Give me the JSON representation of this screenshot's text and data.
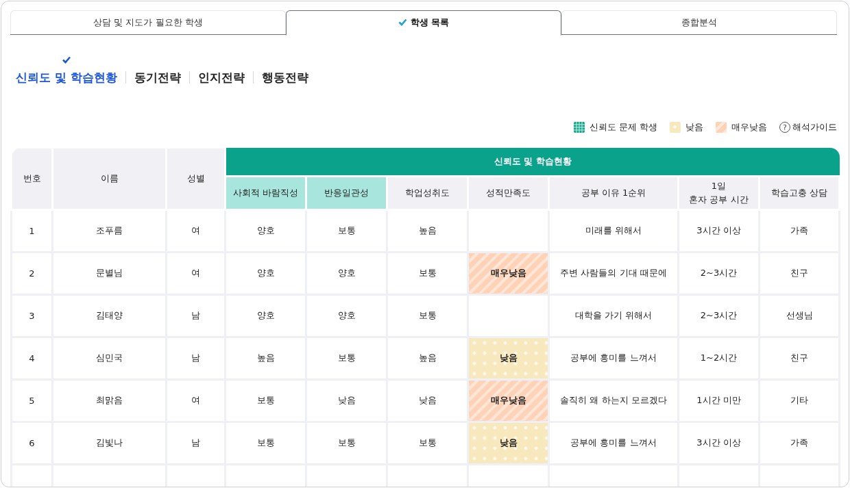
{
  "tabs": [
    {
      "label": "상담 및 지도가 필요한 학생",
      "selected": false
    },
    {
      "label": "학생 목록",
      "selected": true
    },
    {
      "label": "종합분석",
      "selected": false
    }
  ],
  "sub_tabs": [
    {
      "label": "신뢰도 및 학습현황",
      "selected": true
    },
    {
      "label": "동기전략",
      "selected": false
    },
    {
      "label": "인지전략",
      "selected": false
    },
    {
      "label": "행동전략",
      "selected": false
    }
  ],
  "legend": [
    {
      "kind": "reliability",
      "label": "신뢰도 문제 학생"
    },
    {
      "kind": "low",
      "label": "낮음"
    },
    {
      "kind": "very_low",
      "label": "매우낮음"
    },
    {
      "kind": "guide",
      "icon": "?",
      "label": "해석가이드"
    }
  ],
  "table": {
    "columns": [
      "번호",
      "이름",
      "성별"
    ],
    "group": {
      "title": "신뢰도 및 학습현황",
      "columns": [
        {
          "label": "사회적 바람직성",
          "highlighted": true
        },
        {
          "label": "반응일관성",
          "highlighted": true
        },
        {
          "label": "학업성취도",
          "highlighted": false
        },
        {
          "label": "성적만족도",
          "highlighted": false
        },
        {
          "label": "공부 이유 1순위",
          "highlighted": false
        },
        {
          "label": "1일\n혼자 공부 시간",
          "highlighted": false
        },
        {
          "label": "학습고충 상담",
          "highlighted": false
        }
      ]
    },
    "rows": [
      {
        "no": "1",
        "name": "조푸름",
        "gender": "여",
        "values": [
          "양호",
          "보통",
          "높음"
        ],
        "rest": [
          "미래를 위해서",
          "3시간 이상",
          "가족"
        ]
      },
      {
        "no": "2",
        "name": "문별님",
        "gender": "여",
        "values": [
          "양호",
          "양호",
          "보통"
        ],
        "satisfaction": {
          "label": "매우낮음",
          "kind": "very_low"
        },
        "rest": [
          "주변 사람들의 기대 때문에",
          "2~3시간",
          "친구"
        ]
      },
      {
        "no": "3",
        "name": "김태양",
        "gender": "남",
        "values": [
          "양호",
          "양호",
          "보통"
        ],
        "rest": [
          "대학을 가기 위해서",
          "2~3시간",
          "선생님"
        ]
      },
      {
        "no": "4",
        "name": "심민국",
        "gender": "남",
        "values": [
          "높음",
          "보통",
          "높음"
        ],
        "satisfaction": {
          "label": "낮음",
          "kind": "low"
        },
        "rest": [
          "공부에 흥미를 느껴서",
          "1~2시간",
          "친구"
        ]
      },
      {
        "no": "5",
        "name": "최맑음",
        "gender": "여",
        "values": [
          "보통",
          "낮음",
          "낮음"
        ],
        "satisfaction": {
          "label": "매우낮음",
          "kind": "very_low"
        },
        "rest": [
          "솔직히 왜 하는지 모르겠다",
          "1시간 미만",
          "기타"
        ]
      },
      {
        "no": "6",
        "name": "김빛나",
        "gender": "남",
        "values": [
          "보통",
          "보통",
          "보통"
        ],
        "satisfaction": {
          "label": "낮음",
          "kind": "low"
        },
        "rest": [
          "공부에 흥미를 느껴서",
          "3시간 이상",
          "가족"
        ]
      }
    ]
  }
}
